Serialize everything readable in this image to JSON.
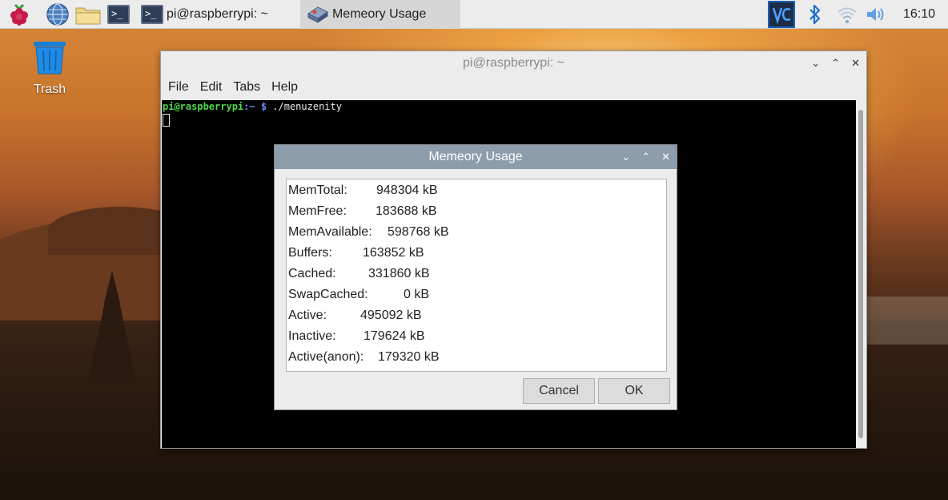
{
  "taskbar": {
    "terminal_task_label": "pi@raspberrypi: ~",
    "dialog_task_label": "Memeory Usage",
    "clock": "16:10"
  },
  "desktop": {
    "trash_label": "Trash"
  },
  "terminal": {
    "title": "pi@raspberrypi: ~",
    "menu": [
      "File",
      "Edit",
      "Tabs",
      "Help"
    ],
    "prompt_user": "pi@raspberrypi",
    "prompt_path": ":~",
    "prompt_symbol": " $",
    "command": " ./menuzenity"
  },
  "dialog": {
    "title": "Memeory Usage",
    "rows": [
      {
        "label": "MemTotal:",
        "value": "948304 kB"
      },
      {
        "label": "MemFree:",
        "value": "183688 kB"
      },
      {
        "label": "MemAvailable:",
        "value": "598768 kB"
      },
      {
        "label": "Buffers:",
        "value": "163852 kB"
      },
      {
        "label": "Cached:",
        "value": "331860 kB"
      },
      {
        "label": "SwapCached:",
        "value": "0 kB"
      },
      {
        "label": "Active:",
        "value": "495092 kB"
      },
      {
        "label": "Inactive:",
        "value": "179624 kB"
      },
      {
        "label": "Active(anon):",
        "value": "179320 kB"
      }
    ],
    "cancel_label": "Cancel",
    "ok_label": "OK"
  },
  "colors": {
    "taskbar_bg": "#ececec",
    "dialog_title_bg": "#8e9dac",
    "terminal_bg": "#000000",
    "prompt_user": "#4fd64f",
    "prompt_path": "#6e8ff5",
    "vnc_blue": "#1f5fb8"
  },
  "icons": {
    "menu": "raspberry-icon",
    "browser": "globe-icon",
    "files": "folder-icon",
    "terminal": "terminal-icon",
    "dialog_task": "hard-drive-icon",
    "tray": [
      "vnc-icon",
      "bluetooth-icon",
      "wifi-icon",
      "volume-icon"
    ],
    "trash": "trash-icon"
  }
}
